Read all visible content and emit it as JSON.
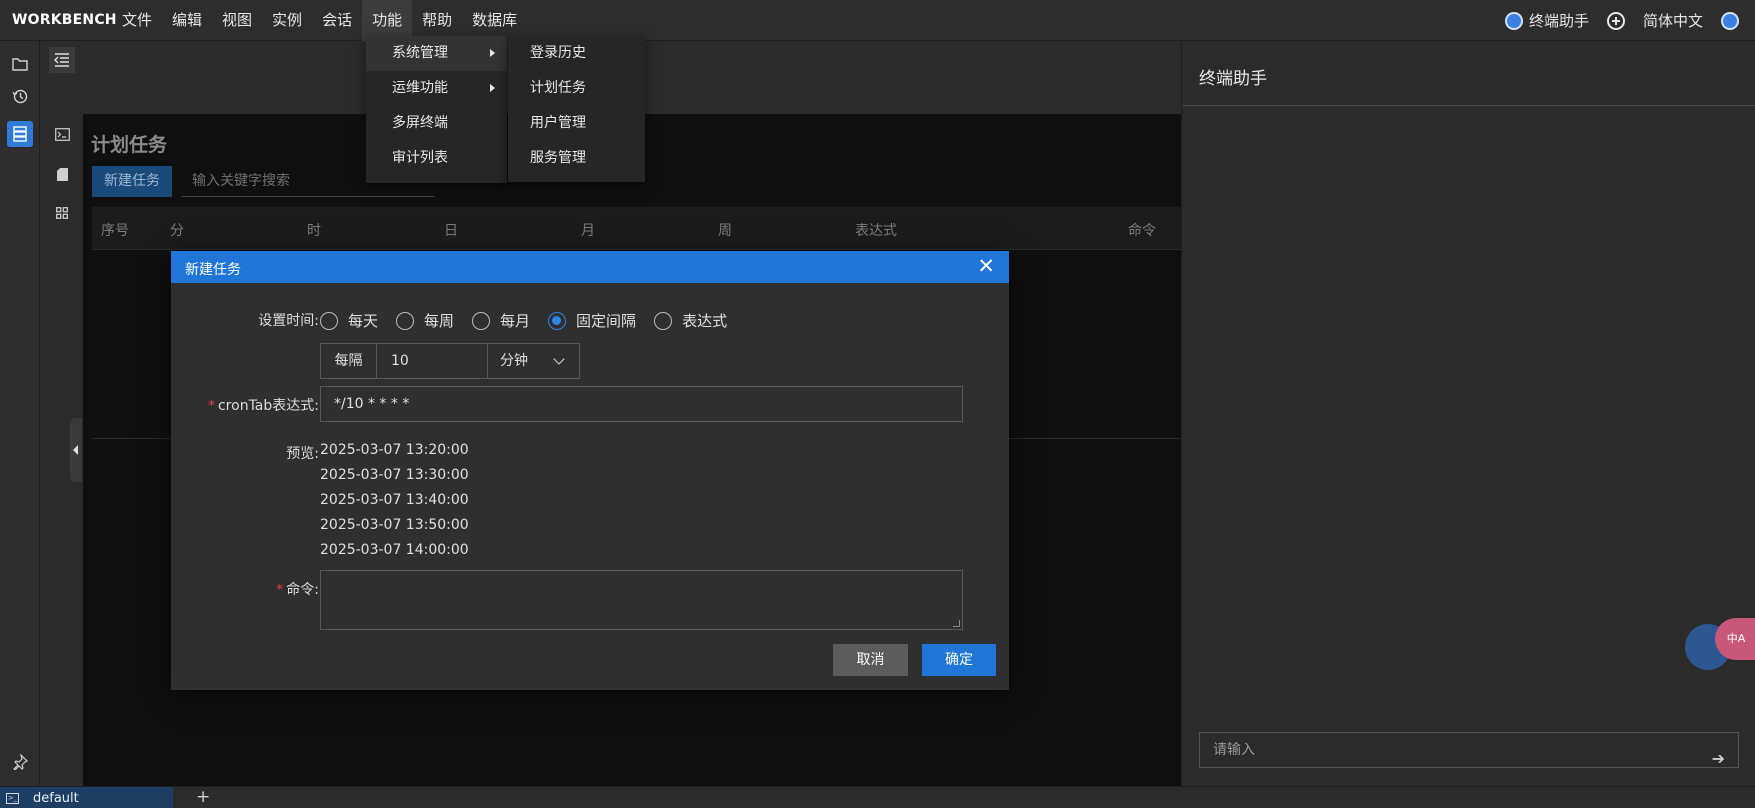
{
  "app": {
    "brand": "WORKBENCH"
  },
  "menubar": {
    "items": [
      "文件",
      "编辑",
      "视图",
      "实例",
      "会话",
      "功能",
      "帮助",
      "数据库"
    ],
    "active": "功能",
    "right": {
      "assistant": "终端助手",
      "language": "简体中文"
    }
  },
  "dropdown": {
    "level1": [
      "系统管理",
      "运维功能",
      "多屏终端",
      "审计列表"
    ],
    "level2": [
      "登录历史",
      "计划任务",
      "用户管理",
      "服务管理"
    ]
  },
  "page": {
    "title": "计划任务",
    "new_button": "新建任务",
    "search_placeholder": "输入关键字搜索",
    "columns": [
      "序号",
      "分",
      "时",
      "日",
      "月",
      "周",
      "表达式",
      "命令"
    ]
  },
  "modal": {
    "title": "新建任务",
    "close": "✕",
    "time_label": "设置时间:",
    "radios": [
      "每天",
      "每周",
      "每月",
      "固定间隔",
      "表达式"
    ],
    "selected_radio": "固定间隔",
    "interval_prefix": "每隔",
    "interval_value": "10",
    "interval_unit": "分钟",
    "cron_label": "cronTab表达式:",
    "cron_value": "*/10 * * * *",
    "preview_label": "预览:",
    "preview": [
      "2025-03-07 13:20:00",
      "2025-03-07 13:30:00",
      "2025-03-07 13:40:00",
      "2025-03-07 13:50:00",
      "2025-03-07 14:00:00"
    ],
    "command_label": "命令:",
    "required_mark": "*",
    "cancel": "取消",
    "confirm": "确定"
  },
  "assistant_panel": {
    "title": "终端助手",
    "input_placeholder": "请输入",
    "float_label": "中A"
  },
  "statusbar": {
    "tab_label": "default",
    "add": "+"
  },
  "colors": {
    "accent": "#1f76d6",
    "required": "#e04040",
    "active_nav": "#2f7bd6"
  },
  "icons": {
    "rail": [
      "folder-icon",
      "history-icon",
      "database-icon",
      "pin-icon"
    ],
    "rail2": [
      "collapse-icon",
      "terminal-icon",
      "file-icon",
      "grid-icon"
    ]
  }
}
